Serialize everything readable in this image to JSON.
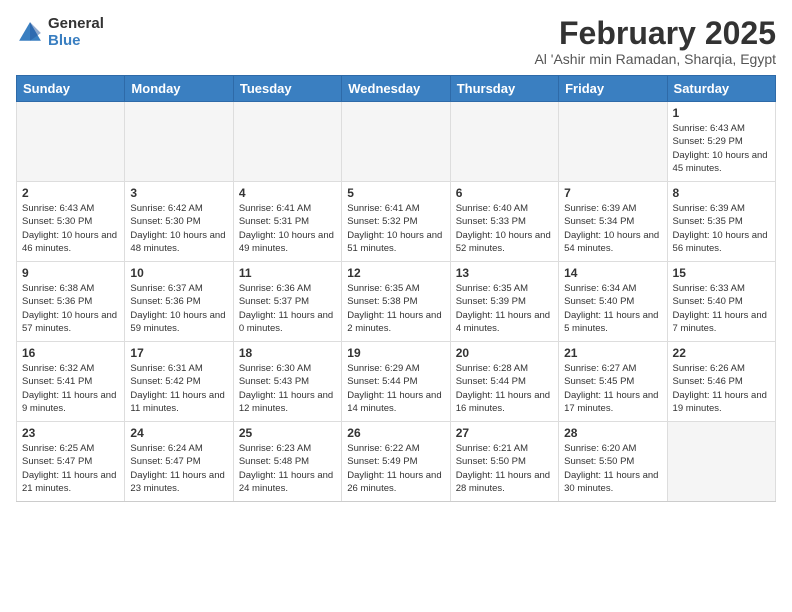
{
  "logo": {
    "general": "General",
    "blue": "Blue"
  },
  "header": {
    "month": "February 2025",
    "location": "Al 'Ashir min Ramadan, Sharqia, Egypt"
  },
  "weekdays": [
    "Sunday",
    "Monday",
    "Tuesday",
    "Wednesday",
    "Thursday",
    "Friday",
    "Saturday"
  ],
  "weeks": [
    [
      {
        "day": "",
        "info": ""
      },
      {
        "day": "",
        "info": ""
      },
      {
        "day": "",
        "info": ""
      },
      {
        "day": "",
        "info": ""
      },
      {
        "day": "",
        "info": ""
      },
      {
        "day": "",
        "info": ""
      },
      {
        "day": "1",
        "info": "Sunrise: 6:43 AM\nSunset: 5:29 PM\nDaylight: 10 hours and 45 minutes."
      }
    ],
    [
      {
        "day": "2",
        "info": "Sunrise: 6:43 AM\nSunset: 5:30 PM\nDaylight: 10 hours and 46 minutes."
      },
      {
        "day": "3",
        "info": "Sunrise: 6:42 AM\nSunset: 5:30 PM\nDaylight: 10 hours and 48 minutes."
      },
      {
        "day": "4",
        "info": "Sunrise: 6:41 AM\nSunset: 5:31 PM\nDaylight: 10 hours and 49 minutes."
      },
      {
        "day": "5",
        "info": "Sunrise: 6:41 AM\nSunset: 5:32 PM\nDaylight: 10 hours and 51 minutes."
      },
      {
        "day": "6",
        "info": "Sunrise: 6:40 AM\nSunset: 5:33 PM\nDaylight: 10 hours and 52 minutes."
      },
      {
        "day": "7",
        "info": "Sunrise: 6:39 AM\nSunset: 5:34 PM\nDaylight: 10 hours and 54 minutes."
      },
      {
        "day": "8",
        "info": "Sunrise: 6:39 AM\nSunset: 5:35 PM\nDaylight: 10 hours and 56 minutes."
      }
    ],
    [
      {
        "day": "9",
        "info": "Sunrise: 6:38 AM\nSunset: 5:36 PM\nDaylight: 10 hours and 57 minutes."
      },
      {
        "day": "10",
        "info": "Sunrise: 6:37 AM\nSunset: 5:36 PM\nDaylight: 10 hours and 59 minutes."
      },
      {
        "day": "11",
        "info": "Sunrise: 6:36 AM\nSunset: 5:37 PM\nDaylight: 11 hours and 0 minutes."
      },
      {
        "day": "12",
        "info": "Sunrise: 6:35 AM\nSunset: 5:38 PM\nDaylight: 11 hours and 2 minutes."
      },
      {
        "day": "13",
        "info": "Sunrise: 6:35 AM\nSunset: 5:39 PM\nDaylight: 11 hours and 4 minutes."
      },
      {
        "day": "14",
        "info": "Sunrise: 6:34 AM\nSunset: 5:40 PM\nDaylight: 11 hours and 5 minutes."
      },
      {
        "day": "15",
        "info": "Sunrise: 6:33 AM\nSunset: 5:40 PM\nDaylight: 11 hours and 7 minutes."
      }
    ],
    [
      {
        "day": "16",
        "info": "Sunrise: 6:32 AM\nSunset: 5:41 PM\nDaylight: 11 hours and 9 minutes."
      },
      {
        "day": "17",
        "info": "Sunrise: 6:31 AM\nSunset: 5:42 PM\nDaylight: 11 hours and 11 minutes."
      },
      {
        "day": "18",
        "info": "Sunrise: 6:30 AM\nSunset: 5:43 PM\nDaylight: 11 hours and 12 minutes."
      },
      {
        "day": "19",
        "info": "Sunrise: 6:29 AM\nSunset: 5:44 PM\nDaylight: 11 hours and 14 minutes."
      },
      {
        "day": "20",
        "info": "Sunrise: 6:28 AM\nSunset: 5:44 PM\nDaylight: 11 hours and 16 minutes."
      },
      {
        "day": "21",
        "info": "Sunrise: 6:27 AM\nSunset: 5:45 PM\nDaylight: 11 hours and 17 minutes."
      },
      {
        "day": "22",
        "info": "Sunrise: 6:26 AM\nSunset: 5:46 PM\nDaylight: 11 hours and 19 minutes."
      }
    ],
    [
      {
        "day": "23",
        "info": "Sunrise: 6:25 AM\nSunset: 5:47 PM\nDaylight: 11 hours and 21 minutes."
      },
      {
        "day": "24",
        "info": "Sunrise: 6:24 AM\nSunset: 5:47 PM\nDaylight: 11 hours and 23 minutes."
      },
      {
        "day": "25",
        "info": "Sunrise: 6:23 AM\nSunset: 5:48 PM\nDaylight: 11 hours and 24 minutes."
      },
      {
        "day": "26",
        "info": "Sunrise: 6:22 AM\nSunset: 5:49 PM\nDaylight: 11 hours and 26 minutes."
      },
      {
        "day": "27",
        "info": "Sunrise: 6:21 AM\nSunset: 5:50 PM\nDaylight: 11 hours and 28 minutes."
      },
      {
        "day": "28",
        "info": "Sunrise: 6:20 AM\nSunset: 5:50 PM\nDaylight: 11 hours and 30 minutes."
      },
      {
        "day": "",
        "info": ""
      }
    ]
  ]
}
